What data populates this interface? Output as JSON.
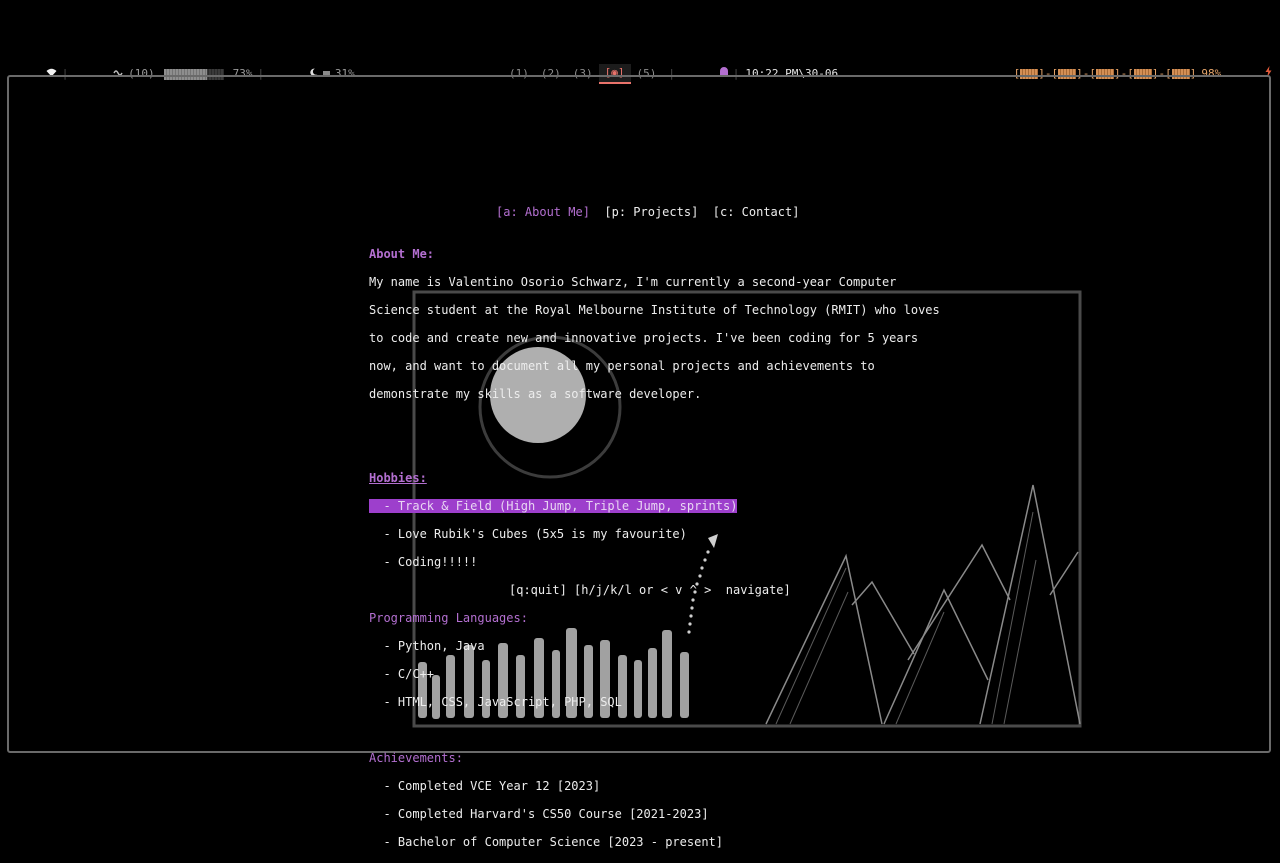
{
  "statusbar": {
    "left": {
      "wifi_icon": "wifi-icon",
      "volume_icon": "volume-icon",
      "volume_level": "(10)",
      "volume_percent_value": 73,
      "volume_percent": "73%",
      "brightness_icon": "moon-icon",
      "brightness_percent": "31%"
    },
    "workspaces": [
      "(1)",
      "(2)",
      "(3)",
      "[◉]",
      "(5)"
    ],
    "active_workspace_index": 3,
    "clock_icon": "ghost-icon",
    "clock": "10:22 PM\\30-06",
    "cpu": [
      "[",
      "]-[",
      "]-[",
      "]-[",
      "]-[",
      "]"
    ],
    "battery_percent": "98%",
    "battery_icon": "lightning-icon",
    "colors": {
      "accent": "#b36fd0",
      "workspace_active": "#e9736b",
      "cpu": "#e6a56a"
    }
  },
  "nav": {
    "about": "[a: About Me]",
    "projects": "[p: Projects]",
    "contact": "[c: Contact]"
  },
  "about": {
    "heading": "About Me:",
    "lines": [
      "My name is Valentino Osorio Schwarz, I'm currently a second-year Computer",
      "Science student at the Royal Melbourne Institute of Technology (RMIT) who loves",
      "to code and create new and innovative projects. I've been coding for 5 years",
      "now, and want to document all my personal projects and achievements to",
      "demonstrate my skills as a software developer."
    ]
  },
  "hobbies": {
    "heading": "Hobbies:",
    "items": [
      "  - Track & Field (High Jump, Triple Jump, sprints)",
      "  - Love Rubik's Cubes (5x5 is my favourite)",
      "  - Coding!!!!!"
    ],
    "selected_index": 0
  },
  "languages": {
    "heading": "Programming Languages:",
    "items": [
      "  - Python, Java",
      "  - C/C++",
      "  - HTML, CSS, JavaScript, PHP, SQL"
    ]
  },
  "achievements": {
    "heading": "Achievements:",
    "items": [
      "  - Completed VCE Year 12 [2023]",
      "  - Completed Harvard's CS50 Course [2021-2023]",
      "  - Bachelor of Computer Science [2023 - present]"
    ]
  },
  "footer": {
    "help": "[q:quit] [h/j/k/l or < v ^ >  navigate]"
  }
}
